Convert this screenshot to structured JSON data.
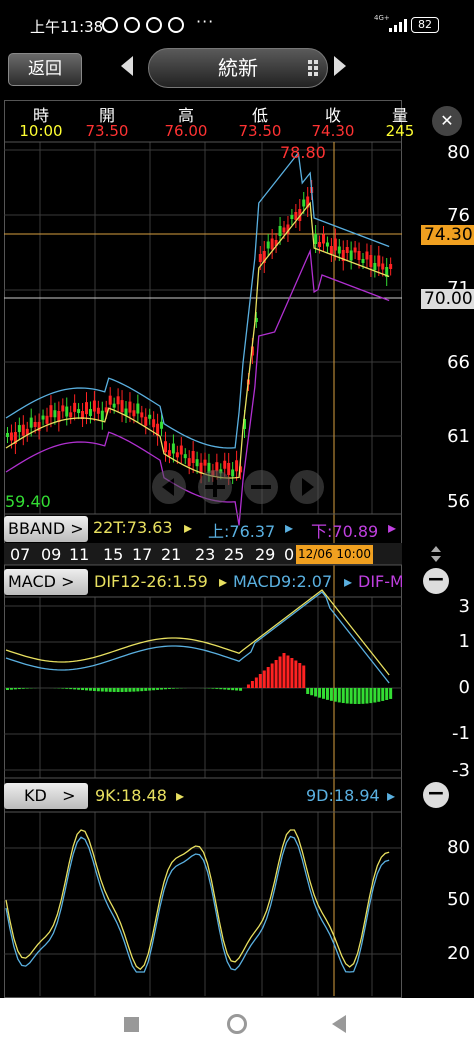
{
  "status_bar": {
    "time": "上午11:38",
    "dots": "···",
    "network": "4G+",
    "battery": "82"
  },
  "topbar": {
    "back_label": "返回",
    "stock_name": "統新"
  },
  "quote": {
    "headers": [
      "時",
      "開",
      "高",
      "低",
      "收",
      "量"
    ],
    "values": [
      "10:00",
      "73.50",
      "76.00",
      "73.50",
      "74.30",
      "245"
    ],
    "value_colors": [
      "#ffff33",
      "#ff3333",
      "#ff3333",
      "#ff3333",
      "#ff3333",
      "#ffff33"
    ]
  },
  "price_chart": {
    "y_ticks": [
      "80",
      "76",
      "71",
      "66",
      "61",
      "56"
    ],
    "high_label": "78.80",
    "low_label": "59.40",
    "close_tag": "74.30",
    "ref_tag": "70.00"
  },
  "bband": {
    "button": "BBAND",
    "t22": "22T:73.63",
    "upper": "上:76.37",
    "lower": "下:70.89"
  },
  "date_axis": {
    "labels": [
      "07",
      "09",
      "11",
      "15",
      "17",
      "21",
      "23",
      "25",
      "29",
      "0"
    ],
    "cursor": "12/06 10:00"
  },
  "macd": {
    "button": "MACD",
    "dif": "DIF12-26:1.59",
    "macd9": "MACD9:2.07",
    "difm": "DIF-M",
    "y_ticks": [
      "3",
      "1",
      "0",
      "-1",
      "-3"
    ]
  },
  "kd": {
    "button": "KD",
    "k": "9K:18.48",
    "d": "9D:18.94",
    "y_ticks": [
      "80",
      "50",
      "20"
    ]
  },
  "nav": {
    "icons": [
      "square-icon",
      "circle-icon",
      "triangle-back-icon"
    ]
  }
}
